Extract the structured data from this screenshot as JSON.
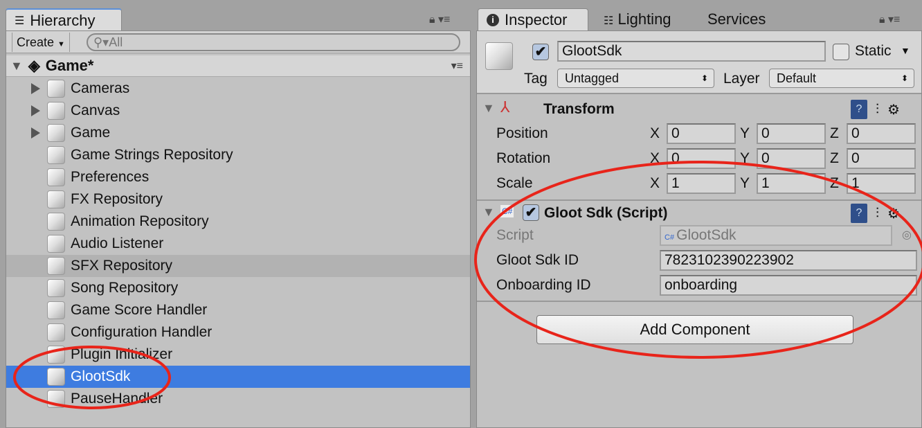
{
  "hierarchy": {
    "tab_label": "Hierarchy",
    "create_label": "Create",
    "search_placeholder": "All",
    "scene_name": "Game*",
    "items": [
      {
        "label": "Cameras",
        "expandable": true
      },
      {
        "label": "Canvas",
        "expandable": true
      },
      {
        "label": "Game",
        "expandable": true
      },
      {
        "label": "Game Strings Repository"
      },
      {
        "label": "Preferences"
      },
      {
        "label": "FX Repository"
      },
      {
        "label": "Animation Repository"
      },
      {
        "label": "Audio Listener"
      },
      {
        "label": "SFX Repository",
        "highlighted": true
      },
      {
        "label": "Song Repository"
      },
      {
        "label": "Game Score Handler"
      },
      {
        "label": "Configuration Handler"
      },
      {
        "label": "Plugin Initializer"
      },
      {
        "label": "GlootSdk",
        "selected": true
      },
      {
        "label": "PauseHandler"
      }
    ]
  },
  "inspector": {
    "tabs": [
      "Inspector",
      "Lighting",
      "Services"
    ],
    "object_name": "GlootSdk",
    "active": true,
    "static_label": "Static",
    "static": false,
    "tag_label": "Tag",
    "tag_value": "Untagged",
    "layer_label": "Layer",
    "layer_value": "Default",
    "transform": {
      "title": "Transform",
      "rows": [
        {
          "label": "Position",
          "x": "0",
          "y": "0",
          "z": "0"
        },
        {
          "label": "Rotation",
          "x": "0",
          "y": "0",
          "z": "0"
        },
        {
          "label": "Scale",
          "x": "1",
          "y": "1",
          "z": "1"
        }
      ],
      "axes": [
        "X",
        "Y",
        "Z"
      ]
    },
    "script_component": {
      "title": "Gloot Sdk (Script)",
      "enabled": true,
      "script_label": "Script",
      "script_value": "GlootSdk",
      "sdk_id_label": "Gloot Sdk ID",
      "sdk_id_value": "7823102390223902",
      "onboarding_label": "Onboarding ID",
      "onboarding_value": "onboarding"
    },
    "add_component_label": "Add Component"
  },
  "colors": {
    "selection": "#3e7ce0",
    "annotation": "#e8241a",
    "panel": "#c2c2c2"
  }
}
